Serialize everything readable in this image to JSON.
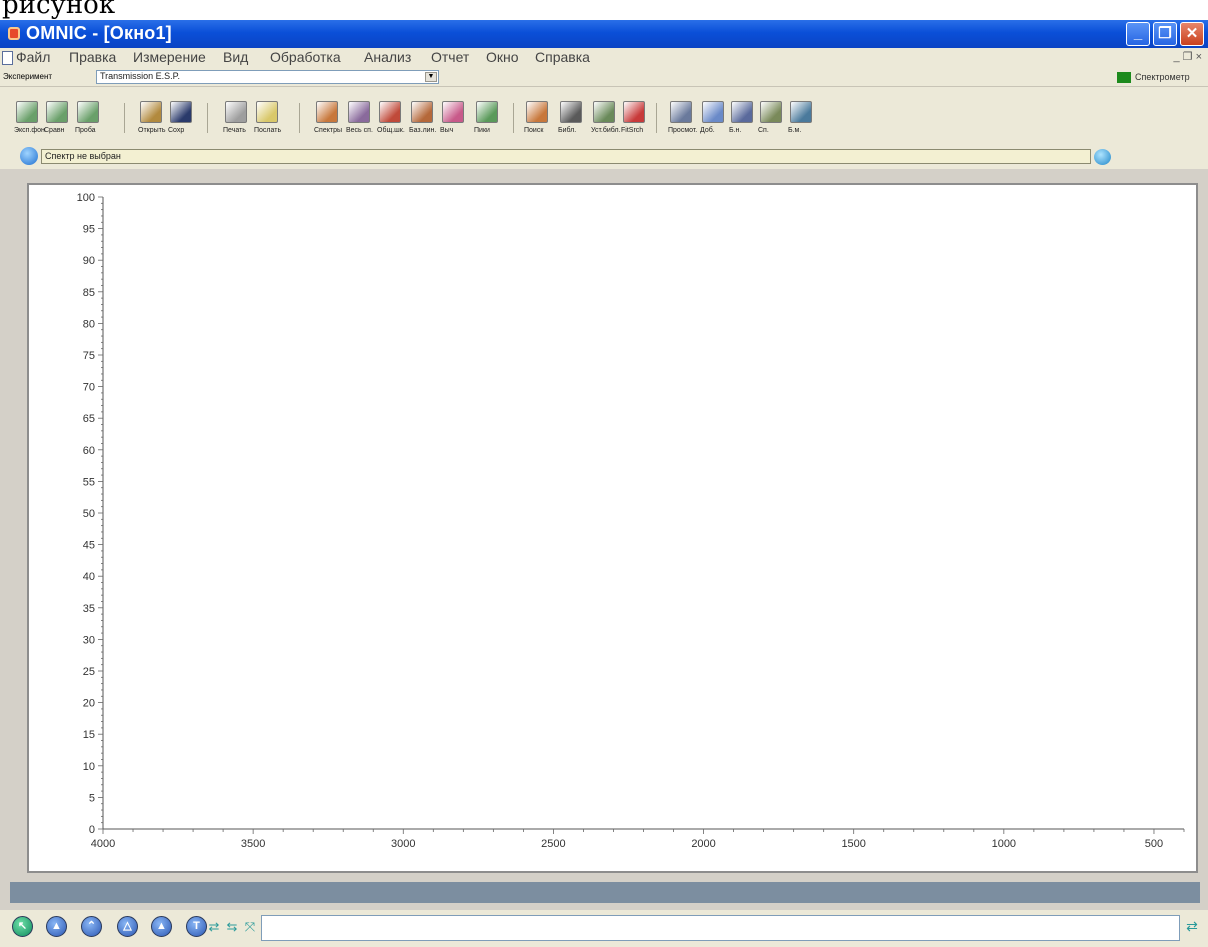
{
  "caption": "рисунок",
  "window": {
    "title": "OMNIC - [Окно1]",
    "buttons": {
      "minimize": "_",
      "restore": "❐",
      "close": "✕"
    }
  },
  "menu": {
    "items": [
      "Файл",
      "Правка",
      "Измерение",
      "Вид",
      "Обработка",
      "Анализ",
      "Отчет",
      "Окно",
      "Справка"
    ],
    "mdi_controls": "_ ❐ ×"
  },
  "experiment": {
    "label": "Эксперимент",
    "selected": "Transmission E.S.P.",
    "right_label": "Спектрометр"
  },
  "toolbar": {
    "buttons": [
      {
        "label": "Эксп.фон",
        "icon": "collect-bg-icon",
        "color": "#6aa06a"
      },
      {
        "label": "Сравн",
        "icon": "collect-compare-icon",
        "color": "#6aa06a"
      },
      {
        "label": "Проба",
        "icon": "collect-sample-icon",
        "color": "#6aa06a"
      },
      {
        "label": "Открыть",
        "icon": "open-icon",
        "color": "#b28a3e"
      },
      {
        "label": "Сохр",
        "icon": "save-icon",
        "color": "#2a3a6b"
      },
      {
        "label": "Печать",
        "icon": "print-icon",
        "color": "#9e9e9e"
      },
      {
        "label": "Послать",
        "icon": "send-icon",
        "color": "#d9c86a"
      },
      {
        "label": "Спектры",
        "icon": "spectra-icon",
        "color": "#c8783c"
      },
      {
        "label": "Весь сп.",
        "icon": "full-scale-icon",
        "color": "#8a6a9c"
      },
      {
        "label": "Общ.шк.",
        "icon": "common-scale-icon",
        "color": "#c04a3a"
      },
      {
        "label": "Баз.лин.",
        "icon": "baseline-icon",
        "color": "#b5683a"
      },
      {
        "label": "Выч",
        "icon": "subtract-icon",
        "color": "#c85a8a"
      },
      {
        "label": "Пики",
        "icon": "peaks-icon",
        "color": "#5a9a5a"
      },
      {
        "label": "Поиск",
        "icon": "search-icon",
        "color": "#c8783c"
      },
      {
        "label": "Библ.",
        "icon": "library-icon",
        "color": "#5a5a5a"
      },
      {
        "label": "Уст.библ.",
        "icon": "library-setup-icon",
        "color": "#6a8a5a"
      },
      {
        "label": "FitSrch",
        "icon": "fit-search-icon",
        "color": "#c83a3a"
      },
      {
        "label": "Просмот.",
        "icon": "preview-icon",
        "color": "#6a7a9c"
      },
      {
        "label": "Доб.",
        "icon": "add-icon",
        "color": "#6a8ac8"
      },
      {
        "label": "Б.н.",
        "icon": "library-2-icon",
        "color": "#5a6a9c"
      },
      {
        "label": "Сп.",
        "icon": "spectrum-icon",
        "color": "#7a8a5a"
      },
      {
        "label": "Б.м.",
        "icon": "library-3-icon",
        "color": "#4a7a9c"
      }
    ]
  },
  "status": {
    "message": "Спектр не выбран"
  },
  "chart_data": {
    "type": "line",
    "x_ticks": [
      "4000",
      "3500",
      "3000",
      "2500",
      "2000",
      "1500",
      "1000",
      "500"
    ],
    "y_ticks": [
      "100",
      "95",
      "90",
      "85",
      "80",
      "75",
      "70",
      "65",
      "60",
      "55",
      "50",
      "45",
      "40",
      "35",
      "30",
      "25",
      "20",
      "15",
      "10",
      "5",
      "0"
    ],
    "xlim": [
      4000,
      400
    ],
    "ylim": [
      0,
      100
    ],
    "series": []
  },
  "bottom_tools": [
    {
      "icon": "pointer-icon",
      "symbol": "↖"
    },
    {
      "icon": "region-tool-icon",
      "symbol": "▲"
    },
    {
      "icon": "peak-height-tool-icon",
      "symbol": "⌃"
    },
    {
      "icon": "peak-area-tool-icon",
      "symbol": "△"
    },
    {
      "icon": "baseline-tool-icon",
      "symbol": "▲"
    },
    {
      "icon": "text-tool-icon",
      "symbol": "T"
    }
  ],
  "zoom_tools": [
    {
      "icon": "zoom-in-x-icon",
      "symbol": "⇄"
    },
    {
      "icon": "zoom-out-x-icon",
      "symbol": "⇆"
    },
    {
      "icon": "zoom-fit-icon",
      "symbol": "⤧"
    }
  ],
  "command_line": {
    "value": "",
    "send_icon": "⇄"
  }
}
